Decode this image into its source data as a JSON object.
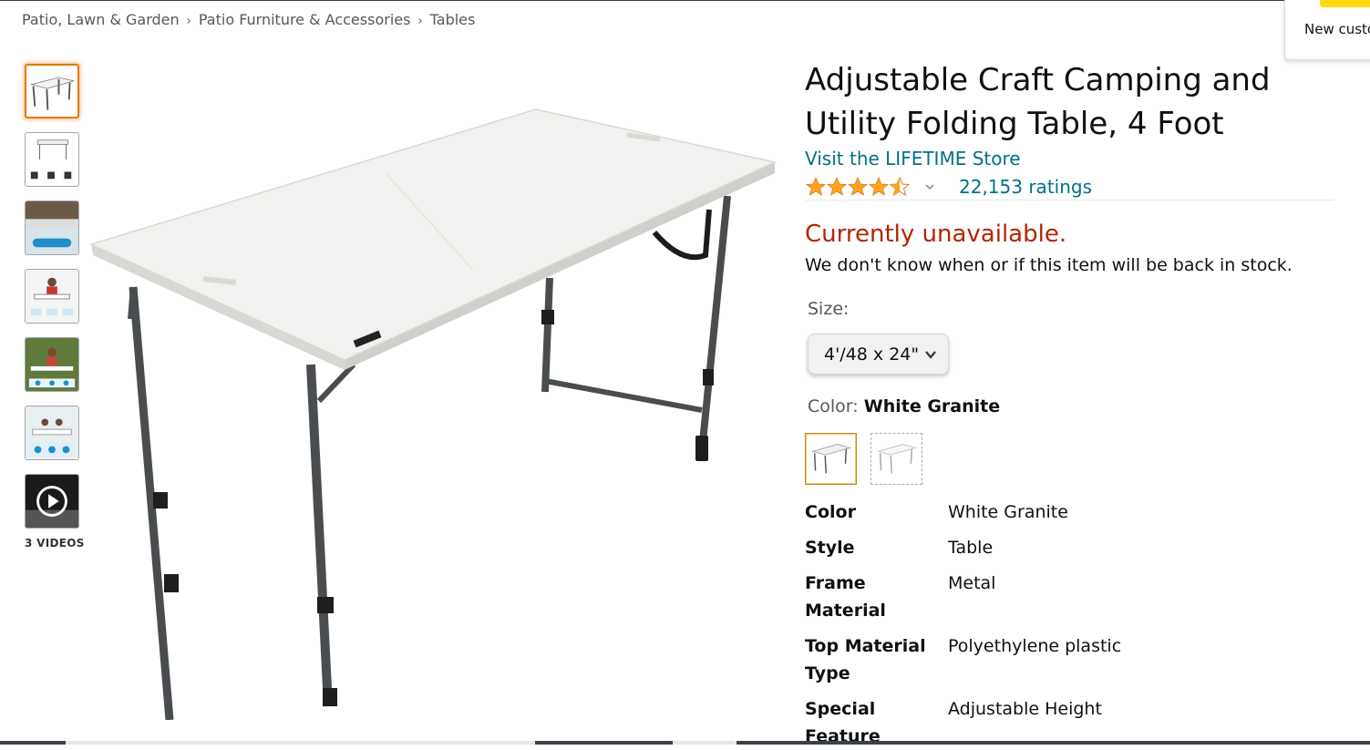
{
  "breadcrumb": {
    "items": [
      "Patio, Lawn & Garden",
      "Patio Furniture & Accessories",
      "Tables"
    ],
    "separator": "›"
  },
  "popover": {
    "text": "New custo"
  },
  "gallery": {
    "thumbnails": [
      "table-front",
      "table-dimensions",
      "table-setup",
      "table-in-use",
      "table-outdoor",
      "table-family"
    ],
    "video_label": "3 VIDEOS",
    "video_icon": "play-icon"
  },
  "product": {
    "title": "Adjustable Craft Camping and Utility Folding Table, 4 Foot",
    "store_link": "Visit the LIFETIME Store",
    "rating": 4.5,
    "ratings_count": "22,153 ratings",
    "availability": "Currently unavailable.",
    "stock_message": "We don't know when or if this item will be back in stock.",
    "size": {
      "label": "Size:",
      "selected": "4'/48 x 24\""
    },
    "color": {
      "label": "Color:",
      "selected": "White Granite"
    },
    "specs": [
      {
        "key": "Color",
        "value": "White Granite"
      },
      {
        "key": "Style",
        "value": "Table"
      },
      {
        "key": "Frame Material",
        "value": "Metal"
      },
      {
        "key": "Top Material Type",
        "value": "Polyethylene plastic"
      },
      {
        "key": "Special Feature",
        "value": "Adjustable Height"
      }
    ]
  },
  "colors": {
    "link": "#007185",
    "unavailable": "#b12704",
    "star": "#ffa41c",
    "selected_border": "#e77600"
  }
}
